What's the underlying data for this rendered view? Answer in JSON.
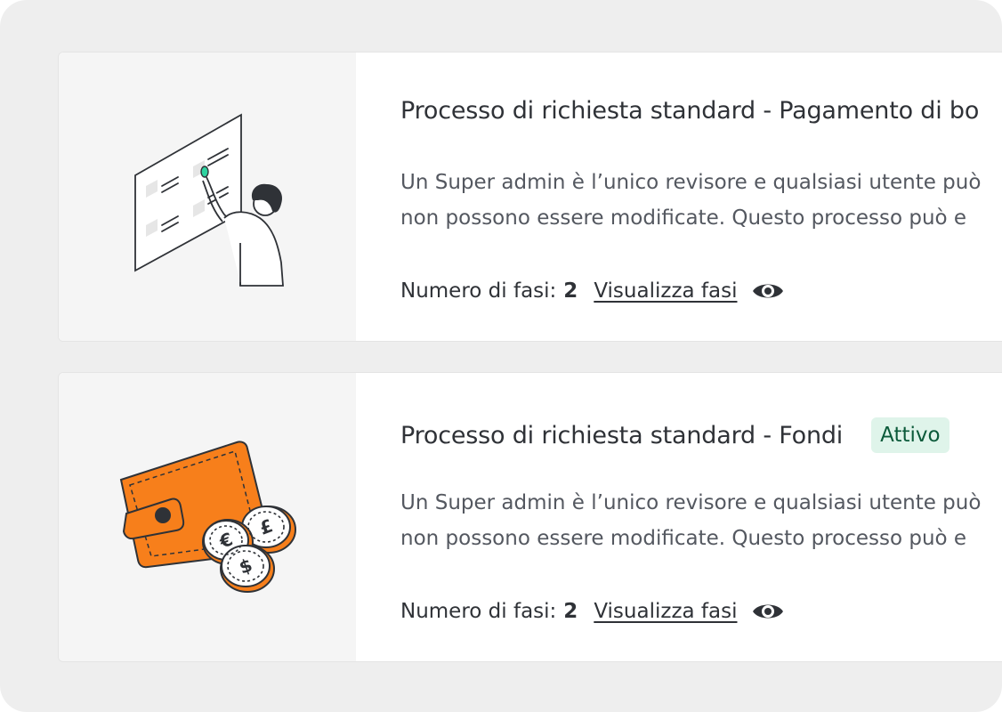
{
  "cards": [
    {
      "title": "Processo di richiesta standard - Pagamento di bo",
      "description": [
        "Un Super admin è l’unico revisore e qualsiasi utente può",
        "non possono essere modificate. Questo processo può e"
      ],
      "steps_label": "Numero di fasi:",
      "steps_count": "2",
      "view_steps_label": "Visualizza fasi",
      "illustration": "person-pointing-at-board"
    },
    {
      "title": "Processo di richiesta standard - Fondi",
      "badge": "Attivo",
      "description": [
        "Un Super admin è l’unico revisore e qualsiasi utente può",
        "non possono essere modificate. Questo processo può e"
      ],
      "steps_label": "Numero di fasi:",
      "steps_count": "2",
      "view_steps_label": "Visualizza fasi",
      "illustration": "wallet-with-coins"
    }
  ],
  "icons": {
    "view": "eye-icon"
  },
  "colors": {
    "badge_bg": "#dff4ea",
    "badge_text": "#0b5a3a",
    "wallet": "#f77f1b",
    "accent_green": "#2fd3a0"
  }
}
